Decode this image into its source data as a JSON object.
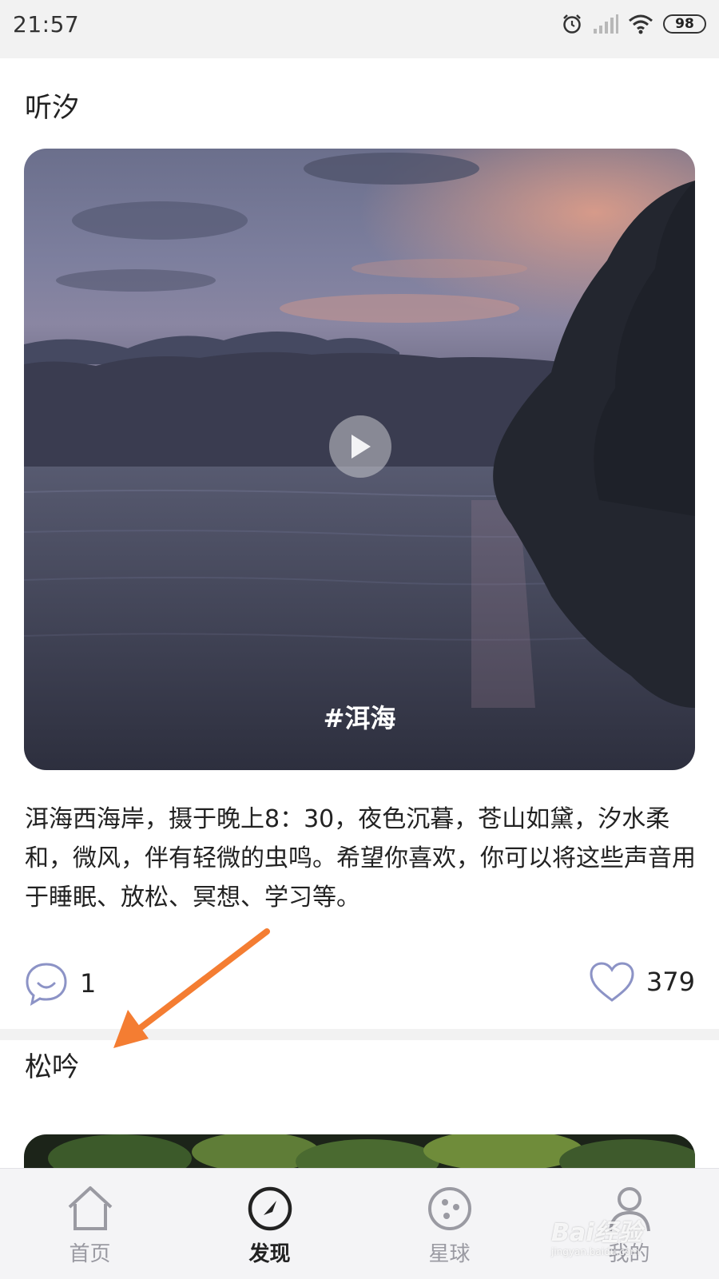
{
  "status_bar": {
    "time": "21:57",
    "battery": "98"
  },
  "feed": [
    {
      "title": "听汐",
      "hashtag": "#洱海",
      "description": "洱海西海岸，摄于晚上8：30，夜色沉暮，苍山如黛，汐水柔和，微风，伴有轻微的虫鸣。希望你喜欢，你可以将这些声音用于睡眠、放松、冥想、学习等。",
      "comments": "1",
      "likes": "379"
    },
    {
      "title": "松吟"
    }
  ],
  "tab_bar": {
    "tabs": [
      {
        "label": "首页",
        "icon": "home-icon"
      },
      {
        "label": "发现",
        "icon": "compass-icon",
        "active": true
      },
      {
        "label": "星球",
        "icon": "planet-icon"
      },
      {
        "label": "我的",
        "icon": "profile-icon"
      }
    ]
  },
  "watermark": {
    "brand": "Bai经验",
    "url": "jingyan.baidu.com"
  }
}
